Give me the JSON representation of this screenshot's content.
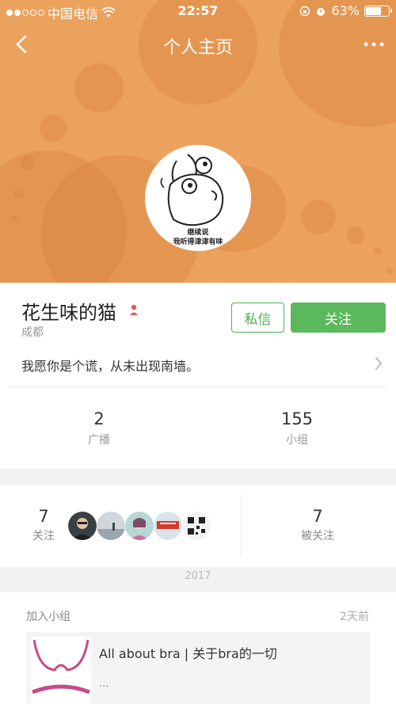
{
  "status_bar": {
    "carrier": "中国电信",
    "time": "22:57",
    "battery": "63%",
    "battery_level": 0.63
  },
  "nav": {
    "title": "个人主页"
  },
  "avatar": {
    "caption_line1": "继续说",
    "caption_line2": "我听得津津有味"
  },
  "profile": {
    "name": "花生味的猫",
    "city": "成都",
    "message_button": "私信",
    "follow_button": "关注",
    "bio": "我愿你是个谎，从未出现南墙。",
    "stats": [
      {
        "num": "2",
        "label": "广播"
      },
      {
        "num": "155",
        "label": "小组"
      }
    ]
  },
  "follows": {
    "following": {
      "num": "7",
      "label": "关注"
    },
    "followers": {
      "num": "7",
      "label": "被关注"
    }
  },
  "timeline": {
    "year": "2017",
    "items": [
      {
        "type": "加入小组",
        "time": "2天前",
        "group_title": "All about bra | 关于bra的一切",
        "group_desc": "..."
      }
    ]
  },
  "colors": {
    "banner": "#eba25c",
    "accent_green": "#5cb85c"
  }
}
